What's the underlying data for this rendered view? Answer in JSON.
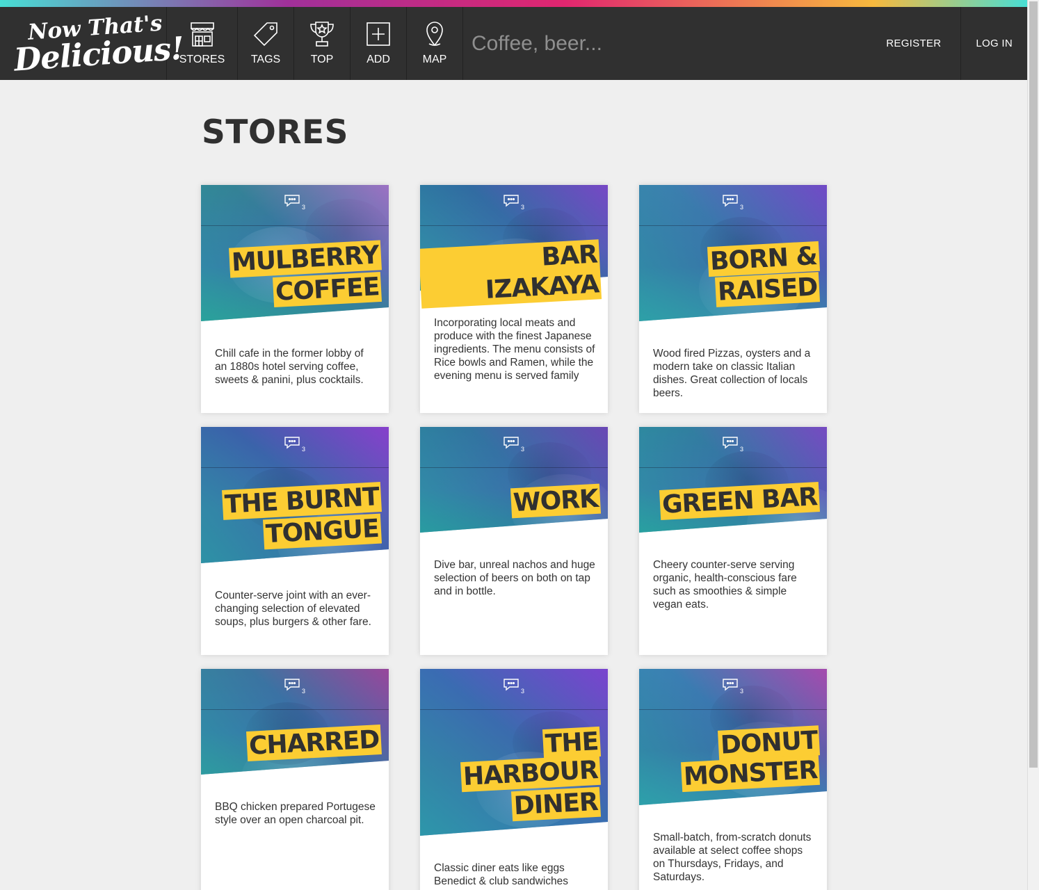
{
  "brand": {
    "line1": "Now That's",
    "line2": "Delicious!"
  },
  "nav": {
    "items": [
      {
        "label": "STORES",
        "icon": "store-icon"
      },
      {
        "label": "TAGS",
        "icon": "tag-icon"
      },
      {
        "label": "TOP",
        "icon": "trophy-icon"
      },
      {
        "label": "ADD",
        "icon": "add-icon"
      },
      {
        "label": "MAP",
        "icon": "map-pin-icon"
      }
    ],
    "search_placeholder": "Coffee, beer...",
    "register": "REGISTER",
    "login": "LOG IN"
  },
  "page_title": "STORES",
  "colors": {
    "nav_bg": "#303030",
    "title_highlight": "#fccd33",
    "page_bg": "#efefef"
  },
  "stores": [
    {
      "title_lines": [
        "MULBERRY",
        "COFFEE"
      ],
      "comments": "3",
      "description": "Chill cafe in the former lobby of an 1880s hotel serving coffee, sweets & panini, plus cocktails."
    },
    {
      "title_lines": [
        "BAR IZAKAYA"
      ],
      "comments": "3",
      "description": "Incorporating local meats and produce with the finest Japanese ingredients. The menu consists of Rice bowls and Ramen, while the evening menu is served family"
    },
    {
      "title_lines": [
        "BORN &",
        "RAISED"
      ],
      "comments": "3",
      "description": "Wood fired Pizzas, oysters and a modern take on classic Italian dishes. Great collection of locals beers."
    },
    {
      "title_lines": [
        "THE BURNT",
        "TONGUE"
      ],
      "comments": "3",
      "description": "Counter-serve joint with an ever-changing selection of elevated soups, plus burgers & other fare."
    },
    {
      "title_lines": [
        "WORK"
      ],
      "comments": "3",
      "description": "Dive bar, unreal nachos and huge selection of beers on both on tap and in bottle."
    },
    {
      "title_lines": [
        "GREEN BAR"
      ],
      "comments": "3",
      "description": "Cheery counter-serve serving organic, health-conscious fare such as smoothies & simple vegan eats."
    },
    {
      "title_lines": [
        "CHARRED"
      ],
      "comments": "3",
      "description": "BBQ chicken prepared Portugese style over an open charcoal pit."
    },
    {
      "title_lines": [
        "THE",
        "HARBOUR",
        "DINER"
      ],
      "comments": "3",
      "description": "Classic diner eats like eggs Benedict & club sandwiches"
    },
    {
      "title_lines": [
        "DONUT",
        "MONSTER"
      ],
      "comments": "3",
      "description": "Small-batch, from-scratch donuts available at select coffee shops on Thursdays, Fridays, and Saturdays."
    }
  ]
}
